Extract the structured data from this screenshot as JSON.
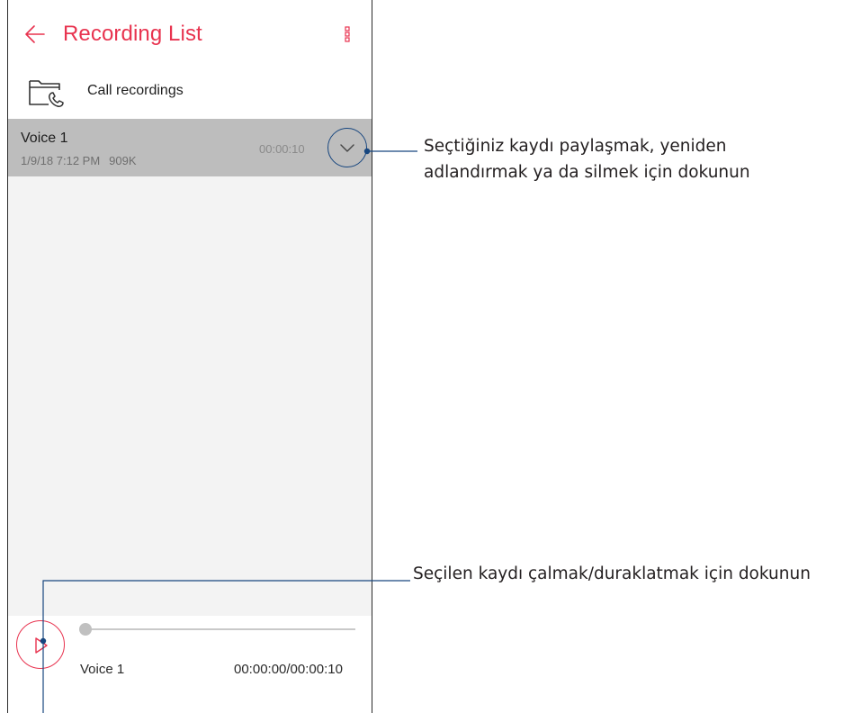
{
  "header": {
    "title": "Recording List",
    "back_icon": "arrow-left-icon",
    "menu_icon": "more-vert-icon",
    "accent_color": "#e8334f"
  },
  "folder": {
    "label": "Call recordings",
    "icon": "folder-phone-icon"
  },
  "recordings": [
    {
      "name": "Voice 1",
      "date": "1/9/18 7:12 PM",
      "size": "909K",
      "duration": "00:00:10",
      "selected": true,
      "expand_icon": "chevron-down-icon"
    }
  ],
  "player": {
    "name": "Voice 1",
    "time": "00:00:00/00:00:10",
    "progress": 0,
    "play_icon": "play-icon"
  },
  "callouts": {
    "expand_line1": "Seçtiğiniz kaydı paylaşmak, yeniden",
    "expand_line2": "adlandırmak ya da silmek için dokunun",
    "play": "Seçilen kaydı çalmak/duraklatmak için dokunun",
    "line_color": "#17467f"
  }
}
